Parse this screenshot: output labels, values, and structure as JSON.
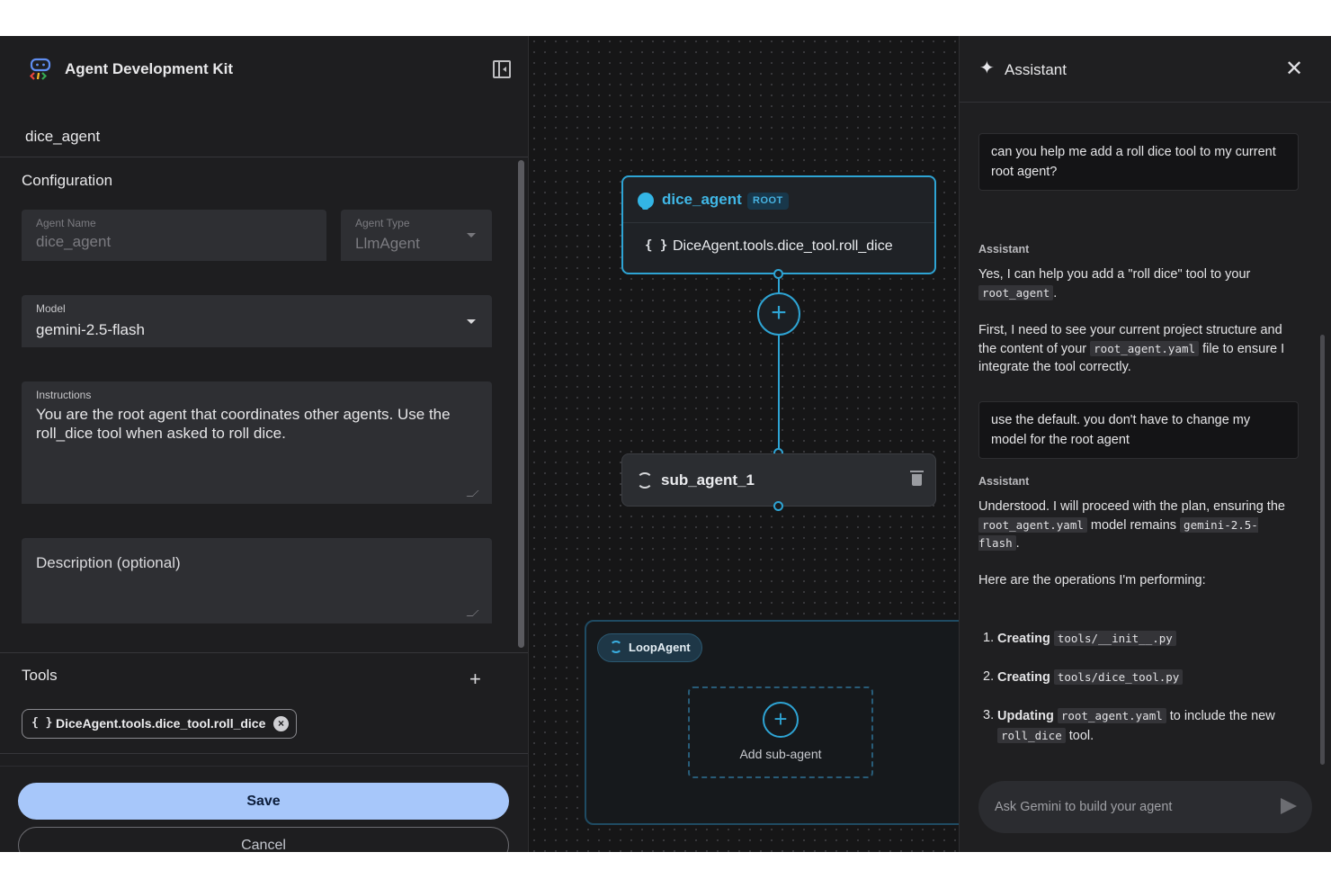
{
  "app": {
    "title": "Agent Development Kit"
  },
  "agent": {
    "name": "dice_agent"
  },
  "config": {
    "section_title": "Configuration",
    "agent_name": {
      "label": "Agent Name",
      "value": "dice_agent"
    },
    "agent_type": {
      "label": "Agent Type",
      "value": "LlmAgent"
    },
    "model": {
      "label": "Model",
      "value": "gemini-2.5-flash"
    },
    "instructions": {
      "label": "Instructions",
      "value": "You are the root agent that coordinates other agents. Use the roll_dice tool when asked to roll dice."
    },
    "description": {
      "placeholder": "Description (optional)"
    }
  },
  "tools": {
    "section_title": "Tools",
    "add_icon": "plus-icon",
    "items": [
      {
        "label": "DiceAgent.tools.dice_tool.roll_dice"
      }
    ]
  },
  "footer": {
    "save_label": "Save",
    "cancel_label": "Cancel"
  },
  "canvas": {
    "root_node": {
      "name": "dice_agent",
      "badge": "ROOT",
      "tool": "DiceAgent.tools.dice_tool.roll_dice"
    },
    "sub_node": {
      "name": "sub_agent_1"
    },
    "loop_group": {
      "label": "LoopAgent",
      "add_label": "Add sub-agent"
    }
  },
  "assistant": {
    "title": "Assistant",
    "role_label": "Assistant",
    "messages": {
      "u1": "can you help me add a roll dice tool to my current root agent?",
      "a1_p1_a": "Yes, I can help you add a \"roll dice\" tool to your",
      "a1_p1_code": "root_agent",
      "a1_p2_a": "First, I need to see your current project structure and the content of your",
      "a1_p2_code": "root_agent.yaml",
      "a1_p2_b": "file to ensure I integrate the tool correctly.",
      "u2": "use the default. you don't have to change my model for the root agent",
      "a2_p1_a": "Understood. I will proceed with the plan, ensuring the",
      "a2_p1_code1": "root_agent.yaml",
      "a2_p1_b": "model remains",
      "a2_p1_code2": "gemini-2.5-flash",
      "a2_p2": "Here are the operations I'm performing:",
      "steps": [
        {
          "num": "1.",
          "verb": "Creating",
          "code": "tools/__init__.py"
        },
        {
          "num": "2.",
          "verb": "Creating",
          "code": "tools/dice_tool.py"
        },
        {
          "num": "3.",
          "verb": "Updating",
          "code": "root_agent.yaml",
          "rest": "to include the new",
          "code2": "roll_dice",
          "rest2": "tool."
        }
      ]
    },
    "input_placeholder": "Ask Gemini to build your agent"
  },
  "colors": {
    "accent": "#2ea4d4",
    "save_button": "#a7c7fa",
    "background": "#1b1b1d"
  }
}
